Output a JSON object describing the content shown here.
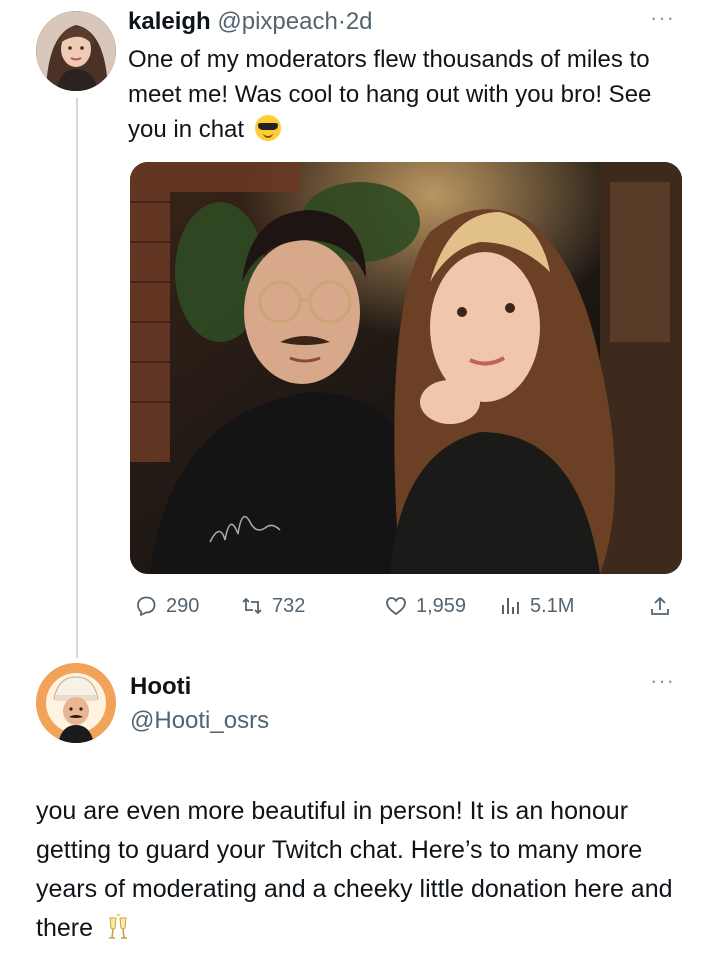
{
  "tweet": {
    "author_name": "kaleigh",
    "author_handle": "@pixpeach",
    "separator": "·",
    "time": "2d",
    "more": "···",
    "text": "One of my moderators flew thousands of miles to meet me! Was cool to hang out with you bro! See you in chat",
    "emoji": "sunglasses-face-icon",
    "media_signature": "kaleigh signature",
    "stats": {
      "replies": "290",
      "retweets": "732",
      "likes": "1,959",
      "views": "5.1M"
    }
  },
  "reply": {
    "author_name": "Hooti",
    "author_handle": "@Hooti_osrs",
    "more": "···",
    "text": "you are even more beautiful in person! It is an honour getting to guard your Twitch chat. Here’s to many more years of moderating and a cheeky little donation here and there",
    "emoji": "clinking-glasses-icon"
  },
  "colors": {
    "text": "#0f1419",
    "secondary": "#536471",
    "thread_line": "#cfd9de"
  }
}
